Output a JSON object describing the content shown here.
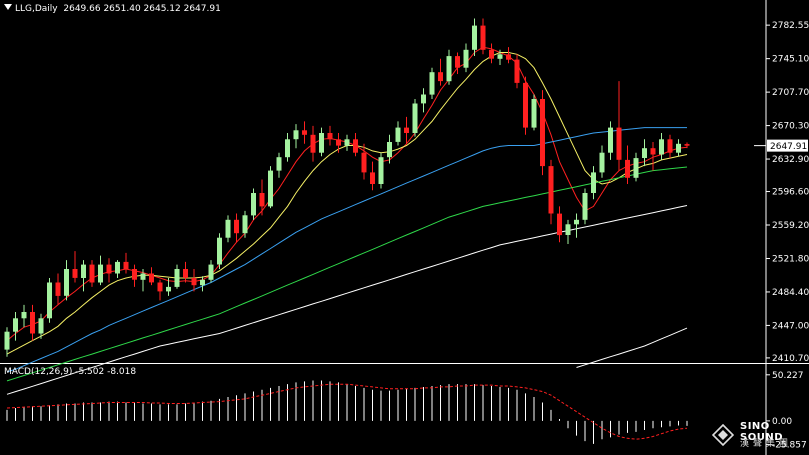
{
  "header": {
    "symbol": "LLG,Daily",
    "ohlc": "2649.66 2651.40 2645.12 2647.91"
  },
  "macd_header": "MACD(12,26,9) -5.502 -8.018",
  "price_axis": {
    "ticks": [
      "2782.55",
      "2745.10",
      "2707.70",
      "2670.30",
      "2632.90",
      "2596.60",
      "2559.20",
      "2521.80",
      "2484.40",
      "2447.00",
      "2410.70"
    ],
    "current_price": "2647.91"
  },
  "macd_axis": {
    "ticks": [
      "50.227",
      "0.00",
      "-25.857"
    ]
  },
  "logo": {
    "line1": "SINO SOUND",
    "line2": "漢聲集團"
  },
  "colors": {
    "up": "#a5f2a0",
    "down": "#ff2020",
    "ma5": "#ff2020",
    "ma10": "#f5f066",
    "ma_blue": "#3aa0f0",
    "ma_green": "#2fd84a",
    "ma_white": "#ffffff",
    "signal": "#ff2020",
    "histogram": "#ffffff",
    "axis": "#ffffff",
    "background": "#000000"
  },
  "chart_data": {
    "type": "candlestick",
    "y_range": [
      2405,
      2795
    ],
    "candles": [
      [
        2420,
        2445,
        2412,
        2440
      ],
      [
        2440,
        2462,
        2430,
        2455
      ],
      [
        2455,
        2470,
        2445,
        2462
      ],
      [
        2462,
        2470,
        2430,
        2438
      ],
      [
        2438,
        2460,
        2432,
        2455
      ],
      [
        2455,
        2500,
        2450,
        2495
      ],
      [
        2495,
        2505,
        2470,
        2480
      ],
      [
        2480,
        2520,
        2475,
        2510
      ],
      [
        2510,
        2530,
        2495,
        2500
      ],
      [
        2500,
        2520,
        2485,
        2515
      ],
      [
        2515,
        2520,
        2490,
        2495
      ],
      [
        2495,
        2525,
        2492,
        2515
      ],
      [
        2515,
        2522,
        2495,
        2505
      ],
      [
        2505,
        2520,
        2500,
        2518
      ],
      [
        2518,
        2528,
        2505,
        2510
      ],
      [
        2510,
        2515,
        2490,
        2498
      ],
      [
        2498,
        2510,
        2485,
        2505
      ],
      [
        2505,
        2512,
        2492,
        2495
      ],
      [
        2495,
        2498,
        2475,
        2485
      ],
      [
        2485,
        2500,
        2480,
        2490
      ],
      [
        2490,
        2515,
        2488,
        2510
      ],
      [
        2510,
        2518,
        2495,
        2500
      ],
      [
        2500,
        2510,
        2485,
        2492
      ],
      [
        2492,
        2502,
        2485,
        2498
      ],
      [
        2498,
        2520,
        2495,
        2515
      ],
      [
        2515,
        2550,
        2510,
        2545
      ],
      [
        2545,
        2570,
        2540,
        2565
      ],
      [
        2565,
        2572,
        2540,
        2550
      ],
      [
        2550,
        2575,
        2545,
        2570
      ],
      [
        2570,
        2600,
        2565,
        2595
      ],
      [
        2595,
        2610,
        2570,
        2580
      ],
      [
        2580,
        2625,
        2578,
        2620
      ],
      [
        2620,
        2640,
        2612,
        2635
      ],
      [
        2635,
        2662,
        2630,
        2655
      ],
      [
        2655,
        2672,
        2645,
        2665
      ],
      [
        2665,
        2675,
        2650,
        2660
      ],
      [
        2660,
        2670,
        2630,
        2640
      ],
      [
        2640,
        2668,
        2636,
        2662
      ],
      [
        2662,
        2670,
        2648,
        2655
      ],
      [
        2655,
        2662,
        2640,
        2648
      ],
      [
        2648,
        2660,
        2642,
        2655
      ],
      [
        2655,
        2662,
        2636,
        2640
      ],
      [
        2640,
        2650,
        2610,
        2618
      ],
      [
        2618,
        2630,
        2598,
        2605
      ],
      [
        2605,
        2640,
        2600,
        2635
      ],
      [
        2635,
        2660,
        2628,
        2652
      ],
      [
        2652,
        2675,
        2648,
        2668
      ],
      [
        2668,
        2680,
        2650,
        2662
      ],
      [
        2662,
        2700,
        2658,
        2695
      ],
      [
        2695,
        2712,
        2685,
        2705
      ],
      [
        2705,
        2735,
        2700,
        2730
      ],
      [
        2730,
        2745,
        2715,
        2720
      ],
      [
        2720,
        2755,
        2716,
        2748
      ],
      [
        2748,
        2752,
        2728,
        2735
      ],
      [
        2735,
        2762,
        2730,
        2755
      ],
      [
        2755,
        2790,
        2748,
        2782
      ],
      [
        2782,
        2790,
        2750,
        2755
      ],
      [
        2755,
        2762,
        2740,
        2745
      ],
      [
        2745,
        2755,
        2738,
        2750
      ],
      [
        2750,
        2758,
        2740,
        2744
      ],
      [
        2744,
        2750,
        2712,
        2718
      ],
      [
        2718,
        2725,
        2660,
        2668
      ],
      [
        2668,
        2705,
        2665,
        2700
      ],
      [
        2700,
        2710,
        2615,
        2625
      ],
      [
        2625,
        2632,
        2560,
        2572
      ],
      [
        2572,
        2580,
        2540,
        2548
      ],
      [
        2548,
        2565,
        2538,
        2560
      ],
      [
        2560,
        2572,
        2545,
        2565
      ],
      [
        2565,
        2600,
        2560,
        2595
      ],
      [
        2595,
        2625,
        2588,
        2618
      ],
      [
        2618,
        2648,
        2612,
        2640
      ],
      [
        2640,
        2675,
        2632,
        2668
      ],
      [
        2668,
        2720,
        2620,
        2632
      ],
      [
        2632,
        2648,
        2605,
        2612
      ],
      [
        2612,
        2640,
        2608,
        2634
      ],
      [
        2634,
        2655,
        2625,
        2645
      ],
      [
        2645,
        2652,
        2620,
        2638
      ],
      [
        2638,
        2662,
        2632,
        2655
      ],
      [
        2655,
        2660,
        2634,
        2640
      ],
      [
        2640,
        2655,
        2636,
        2650
      ],
      [
        2649.66,
        2651.4,
        2645.12,
        2647.91
      ]
    ],
    "moving_averages": [
      {
        "name": "",
        "color": "#ff2020",
        "values": [
          2430,
          2438,
          2445,
          2448,
          2452,
          2462,
          2470,
          2478,
          2485,
          2493,
          2500,
          2504,
          2507,
          2508,
          2510,
          2508,
          2506,
          2503,
          2500,
          2497,
          2496,
          2497,
          2496,
          2498,
          2503,
          2515,
          2528,
          2540,
          2550,
          2565,
          2575,
          2588,
          2600,
          2615,
          2630,
          2642,
          2650,
          2655,
          2656,
          2654,
          2652,
          2648,
          2642,
          2635,
          2630,
          2632,
          2640,
          2650,
          2662,
          2678,
          2693,
          2710,
          2722,
          2735,
          2740,
          2752,
          2758,
          2756,
          2752,
          2748,
          2740,
          2720,
          2705,
          2685,
          2660,
          2630,
          2610,
          2590,
          2575,
          2580,
          2595,
          2610,
          2620,
          2625,
          2628,
          2630,
          2635,
          2638,
          2642,
          2645,
          2646
        ]
      },
      {
        "name": "",
        "color": "#f5f066",
        "values": [
          2415,
          2420,
          2425,
          2430,
          2435,
          2440,
          2446,
          2455,
          2462,
          2470,
          2478,
          2485,
          2492,
          2497,
          2500,
          2502,
          2503,
          2503,
          2502,
          2501,
          2500,
          2500,
          2500,
          2501,
          2503,
          2508,
          2515,
          2522,
          2530,
          2538,
          2547,
          2556,
          2568,
          2580,
          2595,
          2608,
          2620,
          2630,
          2638,
          2644,
          2648,
          2648,
          2646,
          2642,
          2640,
          2641,
          2644,
          2648,
          2655,
          2665,
          2675,
          2688,
          2700,
          2712,
          2722,
          2733,
          2742,
          2748,
          2752,
          2752,
          2750,
          2745,
          2735,
          2718,
          2700,
          2680,
          2660,
          2640,
          2620,
          2610,
          2605,
          2607,
          2612,
          2618,
          2622,
          2626,
          2628,
          2632,
          2634,
          2636,
          2638
        ]
      },
      {
        "name": "",
        "color": "#3aa0f0",
        "values": [
          2395,
          2398,
          2402,
          2406,
          2410,
          2414,
          2418,
          2423,
          2428,
          2433,
          2438,
          2442,
          2447,
          2451,
          2455,
          2459,
          2463,
          2467,
          2471,
          2475,
          2479,
          2483,
          2487,
          2491,
          2495,
          2500,
          2505,
          2510,
          2515,
          2521,
          2527,
          2533,
          2539,
          2545,
          2551,
          2556,
          2561,
          2566,
          2570,
          2574,
          2578,
          2582,
          2586,
          2590,
          2594,
          2598,
          2602,
          2606,
          2610,
          2614,
          2618,
          2622,
          2626,
          2630,
          2634,
          2638,
          2642,
          2645,
          2647,
          2648,
          2648,
          2648,
          2648,
          2650,
          2652,
          2654,
          2656,
          2658,
          2660,
          2662,
          2663,
          2664,
          2665,
          2666,
          2667,
          2668,
          2668,
          2668,
          2668,
          2668,
          2668
        ]
      },
      {
        "name": "",
        "color": "#2fd84a",
        "values": [
          2385,
          2388,
          2391,
          2394,
          2397,
          2400,
          2403,
          2406,
          2409,
          2412,
          2415,
          2418,
          2421,
          2424,
          2427,
          2430,
          2433,
          2436,
          2439,
          2442,
          2445,
          2448,
          2451,
          2454,
          2457,
          2460,
          2464,
          2468,
          2472,
          2476,
          2480,
          2484,
          2488,
          2492,
          2496,
          2500,
          2504,
          2508,
          2512,
          2516,
          2520,
          2524,
          2528,
          2532,
          2536,
          2540,
          2544,
          2548,
          2552,
          2556,
          2560,
          2564,
          2568,
          2571,
          2574,
          2577,
          2580,
          2582,
          2584,
          2586,
          2588,
          2590,
          2592,
          2594,
          2596,
          2598,
          2600,
          2602,
          2604,
          2606,
          2608,
          2610,
          2612,
          2614,
          2616,
          2618,
          2620,
          2621,
          2622,
          2623,
          2624
        ]
      },
      {
        "name": "",
        "color": "#ffffff",
        "values": [
          2370,
          2373,
          2376,
          2379,
          2382,
          2385,
          2388,
          2391,
          2394,
          2397,
          2400,
          2403,
          2406,
          2409,
          2412,
          2415,
          2418,
          2421,
          2424,
          2426,
          2428,
          2430,
          2432,
          2434,
          2436,
          2438,
          2441,
          2444,
          2447,
          2450,
          2453,
          2456,
          2459,
          2462,
          2465,
          2468,
          2471,
          2474,
          2477,
          2480,
          2483,
          2486,
          2489,
          2492,
          2495,
          2498,
          2501,
          2504,
          2507,
          2510,
          2513,
          2516,
          2519,
          2522,
          2525,
          2528,
          2531,
          2534,
          2537,
          2539,
          2541,
          2543,
          2545,
          2547,
          2549,
          2551,
          2553,
          2555,
          2557,
          2559,
          2561,
          2563,
          2565,
          2567,
          2569,
          2571,
          2573,
          2575,
          2577,
          2579,
          2581
        ]
      },
      {
        "name": "",
        "color": "#ffffff",
        "values": [
          null,
          null,
          null,
          null,
          null,
          null,
          null,
          null,
          null,
          null,
          null,
          null,
          null,
          null,
          null,
          null,
          null,
          null,
          null,
          null,
          null,
          null,
          null,
          null,
          null,
          null,
          null,
          null,
          null,
          null,
          null,
          null,
          null,
          null,
          null,
          null,
          null,
          null,
          null,
          null,
          null,
          null,
          null,
          null,
          null,
          null,
          null,
          null,
          null,
          null,
          null,
          null,
          null,
          null,
          null,
          null,
          null,
          null,
          null,
          null,
          null,
          null,
          null,
          null,
          null,
          null,
          null,
          2400,
          2403,
          2406,
          2409,
          2412,
          2415,
          2418,
          2421,
          2424,
          2428,
          2432,
          2436,
          2440,
          2444
        ]
      }
    ],
    "macd": {
      "y_range": [
        -35,
        62
      ],
      "histogram": [
        12,
        14,
        15,
        16,
        16,
        17,
        18,
        19,
        19,
        20,
        20,
        20,
        21,
        21,
        20,
        20,
        19,
        19,
        18,
        18,
        18,
        19,
        20,
        21,
        22,
        24,
        26,
        28,
        30,
        32,
        34,
        36,
        38,
        40,
        42,
        43,
        44,
        44,
        43,
        42,
        40,
        38,
        36,
        34,
        33,
        33,
        34,
        35,
        36,
        37,
        38,
        39,
        40,
        40,
        40,
        40,
        39,
        38,
        37,
        36,
        34,
        30,
        26,
        20,
        12,
        2,
        -8,
        -16,
        -22,
        -25,
        -20,
        -18,
        -15,
        -13,
        -12,
        -10,
        -8,
        -7,
        -6,
        -5,
        -5.502
      ],
      "signal": [
        14,
        14.5,
        15,
        15.5,
        16,
        16.5,
        17,
        17.5,
        18,
        18.5,
        19,
        19.5,
        20,
        20,
        20,
        20,
        20,
        19.5,
        19.5,
        19,
        19,
        19,
        19.5,
        20,
        20.5,
        21,
        22,
        23,
        24,
        26,
        28,
        30,
        32,
        34,
        36,
        37,
        38,
        39,
        40,
        40,
        40,
        39,
        38,
        37,
        36,
        35,
        35,
        35,
        35,
        36,
        36,
        37,
        37,
        38,
        38,
        39,
        39,
        39,
        38,
        38,
        37,
        36,
        34,
        32,
        28,
        22,
        16,
        10,
        4,
        -2,
        -8,
        -13,
        -17,
        -19,
        -20,
        -19,
        -17,
        -14,
        -11,
        -9,
        -8.018
      ]
    }
  }
}
